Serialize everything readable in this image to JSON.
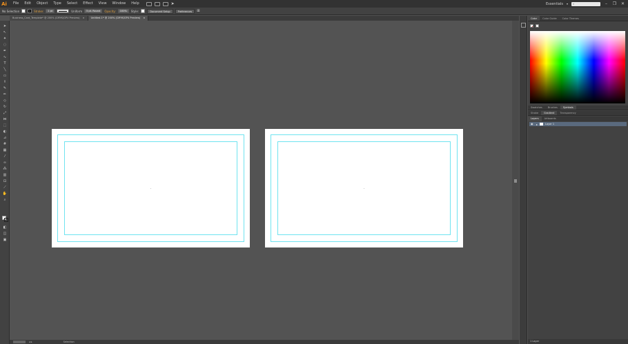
{
  "app": {
    "logo": "Ai"
  },
  "menu": [
    "File",
    "Edit",
    "Object",
    "Type",
    "Select",
    "Effect",
    "View",
    "Window",
    "Help"
  ],
  "topright": {
    "workspace": "Essentials",
    "window_buttons": [
      "–",
      "❐",
      "✕"
    ]
  },
  "control": {
    "selection": "No Selection",
    "stroke_label": "Stroke:",
    "stroke_value": "1 pt",
    "profile": "Uniform",
    "brush": "5 pt. Round",
    "opacity_label": "Opacity:",
    "opacity_value": "100%",
    "style_label": "Style:",
    "doc_setup": "Document Setup",
    "preferences": "Preferences"
  },
  "tabs": [
    {
      "label": "Business_Card_Template* @ 200% (CMYK/GPU Preview)",
      "close": "×",
      "active": false
    },
    {
      "label": "Untitled-1* @ 200% (CMYK/GPU Preview)",
      "close": "×",
      "active": true
    }
  ],
  "panel": {
    "color_tabs": [
      "Color",
      "Color Guide",
      "Color Themes"
    ],
    "swatch_tabs": [
      "Swatches",
      "Brushes",
      "Symbols"
    ],
    "stroke_tabs": [
      "Stroke",
      "Gradient",
      "Transparency"
    ],
    "layers_tabs": [
      "Layers",
      "Artboards"
    ],
    "layer_name": "Layer 1",
    "layers_count": "1 Layer"
  },
  "status": {
    "mode": "Selection"
  }
}
